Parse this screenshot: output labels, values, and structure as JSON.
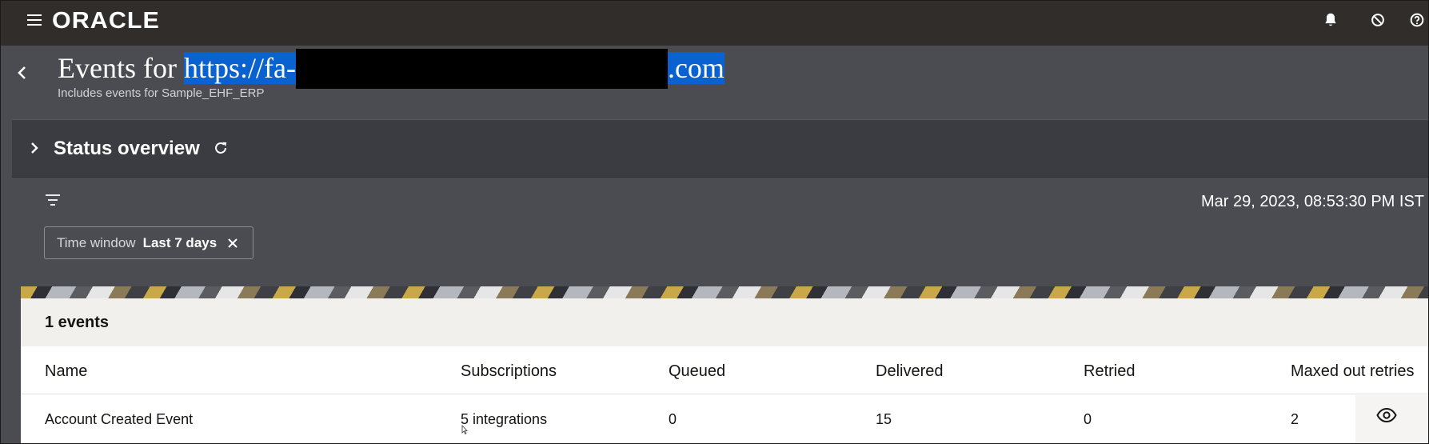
{
  "app": {
    "logo_text": "ORACLE"
  },
  "icons": {
    "menu": "hamburger-menu-icon",
    "bell": "bell-icon",
    "block": "block-icon",
    "help": "help-icon",
    "back": "chevron-left-icon",
    "expand": "chevron-right-icon",
    "refresh": "refresh-icon",
    "filter": "filter-icon",
    "close": "close-icon",
    "view": "eye-icon"
  },
  "header": {
    "title_prefix": "Events for",
    "url_start": "https://fa-",
    "url_end": ".com",
    "subtitle": "Includes events for Sample_EHF_ERP"
  },
  "status": {
    "title": "Status overview"
  },
  "toolbar": {
    "timestamp": "Mar 29, 2023, 08:53:30 PM IST"
  },
  "filter_chip": {
    "label": "Time window",
    "value": "Last 7 days"
  },
  "table": {
    "count_label": "1 events",
    "columns": [
      "Name",
      "Subscriptions",
      "Queued",
      "Delivered",
      "Retried",
      "Maxed out retries"
    ],
    "rows": [
      {
        "name": "Account Created Event",
        "subscriptions": "5 integrations",
        "queued": "0",
        "delivered": "15",
        "retried": "0",
        "maxed_out": "2"
      }
    ]
  },
  "colors": {
    "topbar": "#312d2a",
    "page": "#4a4c51",
    "selection": "#0a62d0",
    "redaction": "#000000"
  }
}
